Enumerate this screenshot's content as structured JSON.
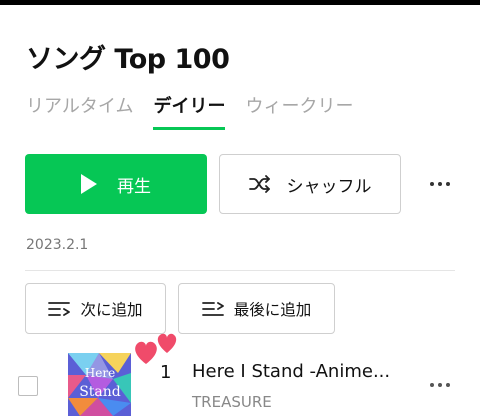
{
  "header": {
    "title": "ソング Top 100"
  },
  "tabs": [
    {
      "label": "リアルタイム",
      "active": false
    },
    {
      "label": "デイリー",
      "active": true
    },
    {
      "label": "ウィークリー",
      "active": false
    }
  ],
  "actions": {
    "play_label": "再生",
    "shuffle_label": "シャッフル"
  },
  "chart_date": "2023.2.1",
  "list_actions": {
    "add_next_label": "次に追加",
    "add_last_label": "最後に追加"
  },
  "tracks": [
    {
      "rank": "1",
      "title": "Here I Stand -Anime...",
      "artist": "TREASURE",
      "cover_text_1": "Here",
      "cover_text_2": "Stand"
    }
  ],
  "colors": {
    "accent": "#06c755",
    "heart": "#f04b6a"
  },
  "icons": {
    "play": "play-icon",
    "shuffle": "shuffle-icon",
    "more": "more-icon",
    "add_next": "add-next-icon",
    "add_last": "add-last-icon",
    "hearts": "hearts-icon"
  }
}
